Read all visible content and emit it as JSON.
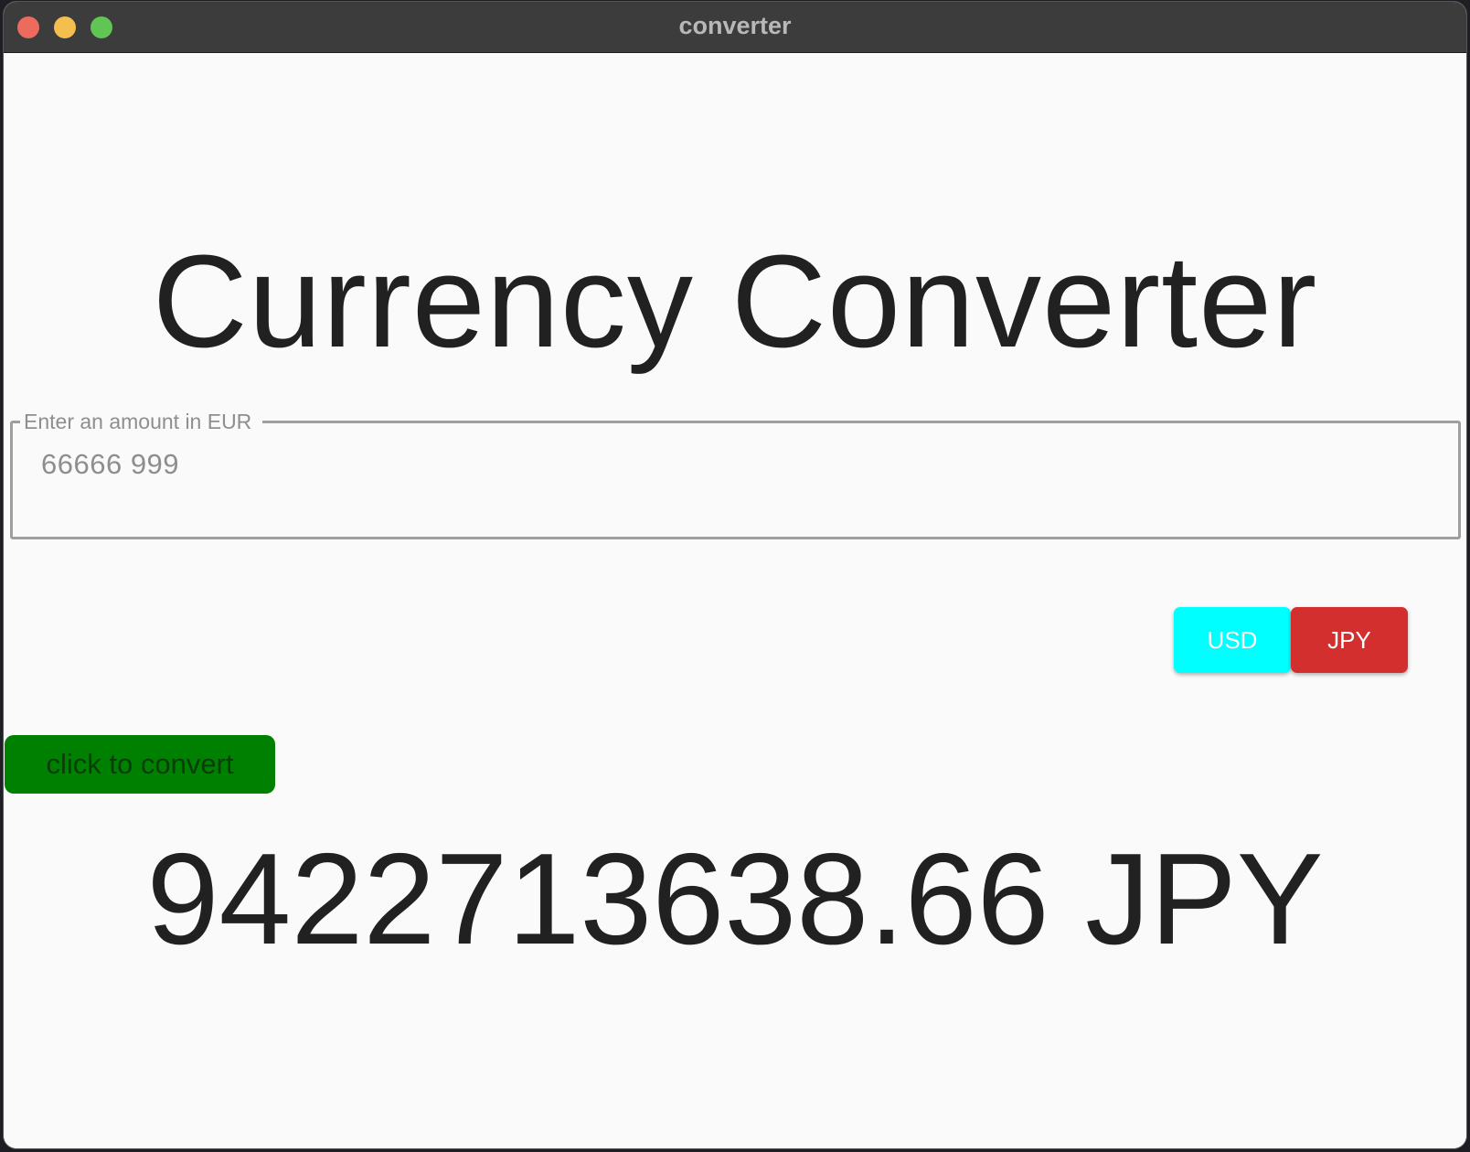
{
  "window": {
    "title": "converter"
  },
  "main": {
    "heading": "Currency Converter",
    "amount_field": {
      "label": "Enter an amount in EUR",
      "value": "66666 999"
    },
    "currency_toggle": {
      "options": [
        {
          "label": "USD",
          "color": "#00ffff",
          "selected": false
        },
        {
          "label": "JPY",
          "color": "#d32f2f",
          "selected": true
        }
      ]
    },
    "convert_button": {
      "label": "click to convert",
      "color": "#008000"
    },
    "result": "9422713638.66 JPY"
  }
}
